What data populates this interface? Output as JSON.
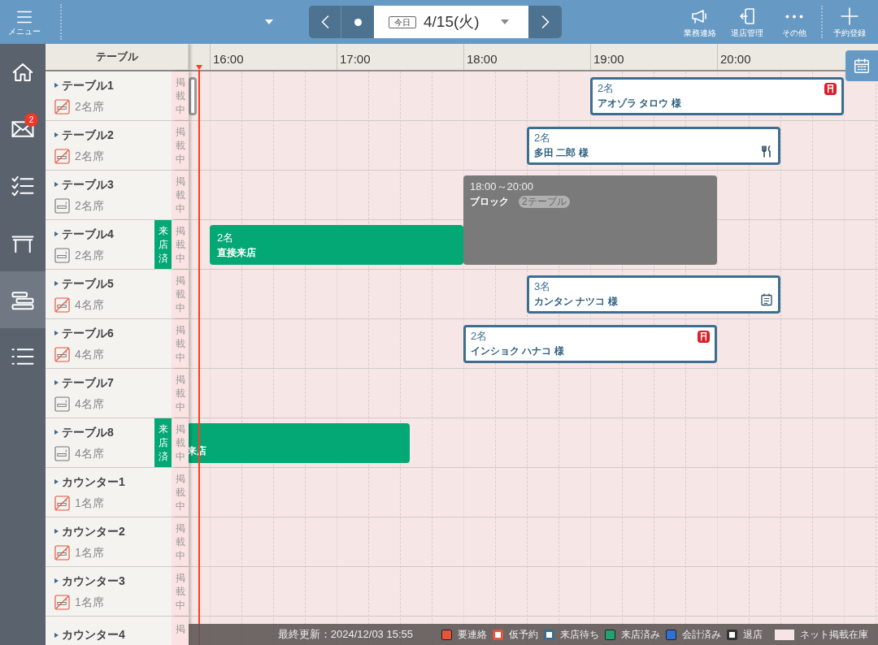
{
  "header": {
    "menu_label": "メニュー",
    "today_label": "今日",
    "date": "4/15(火)",
    "actions": [
      {
        "kind": "megaphone",
        "label": "業務連絡"
      },
      {
        "kind": "exit",
        "label": "退店管理"
      },
      {
        "kind": "more",
        "label": "その他"
      },
      {
        "kind": "plus",
        "label": "予約登録"
      }
    ]
  },
  "sidebar": {
    "items": [
      {
        "kind": "home",
        "selected": false
      },
      {
        "kind": "mail",
        "selected": false,
        "badge": "2"
      },
      {
        "kind": "checklist",
        "selected": false
      },
      {
        "kind": "table",
        "selected": false
      },
      {
        "kind": "timeline",
        "selected": true
      },
      {
        "kind": "list",
        "selected": false
      }
    ]
  },
  "timeline": {
    "column_header": "テーブル",
    "hours": [
      "16:00",
      "17:00",
      "18:00",
      "19:00",
      "20:00"
    ],
    "rows": [
      {
        "name": "テーブル1",
        "seats": "2名席",
        "smoking": false,
        "listed": "掲載中",
        "bookings": [
          {
            "kind": "edge"
          },
          {
            "kind": "reserved",
            "party": "2名",
            "guest": "アオゾラ タロウ 様",
            "marks": [
              {
                "kind": "chair"
              }
            ]
          }
        ]
      },
      {
        "name": "テーブル2",
        "seats": "2名席",
        "smoking": false,
        "listed": "掲載中",
        "bookings": [
          {
            "kind": "reserved",
            "party": "2名",
            "guest": "多田 二郎 様",
            "marks": [
              {
                "kind": "meal"
              }
            ]
          }
        ]
      },
      {
        "name": "テーブル3",
        "seats": "2名席",
        "smoking": true,
        "listed": "掲載中",
        "bookings": [
          {
            "kind": "block",
            "time": "18:00～20:00",
            "title": "ブロック",
            "tag": "2テーブル"
          }
        ]
      },
      {
        "name": "テーブル4",
        "seats": "2名席",
        "smoking": true,
        "listed": "掲載中",
        "visited": "来店済",
        "bookings": [
          {
            "kind": "visited",
            "party": "2名",
            "guest": "直接来店"
          }
        ]
      },
      {
        "name": "テーブル5",
        "seats": "4名席",
        "smoking": false,
        "listed": "掲載中",
        "bookings": [
          {
            "kind": "reserved",
            "party": "3名",
            "guest": "カンタン ナツコ 様",
            "marks": [
              {
                "kind": "memo"
              }
            ]
          }
        ]
      },
      {
        "name": "テーブル6",
        "seats": "4名席",
        "smoking": false,
        "listed": "掲載中",
        "bookings": [
          {
            "kind": "reserved",
            "party": "2名",
            "guest": "インショク ハナコ 様",
            "marks": [
              {
                "kind": "chair"
              }
            ]
          }
        ]
      },
      {
        "name": "テーブル7",
        "seats": "4名席",
        "smoking": true,
        "listed": "掲載中",
        "bookings": []
      },
      {
        "name": "テーブル8",
        "seats": "4名席",
        "smoking": true,
        "listed": "掲載中",
        "visited": "来店済",
        "bookings": [
          {
            "kind": "visited",
            "guest": "来店"
          }
        ]
      },
      {
        "name": "カウンター1",
        "seats": "1名席",
        "smoking": false,
        "listed": "掲載中",
        "bookings": []
      },
      {
        "name": "カウンター2",
        "seats": "1名席",
        "smoking": false,
        "listed": "掲載中",
        "bookings": []
      },
      {
        "name": "カウンター3",
        "seats": "1名席",
        "smoking": false,
        "listed": "掲載中",
        "bookings": []
      },
      {
        "name": "カウンター4",
        "listed": "掲",
        "bookings": []
      }
    ]
  },
  "status_bar": {
    "updated": "最終更新：2024/12/03 15:55",
    "legend": [
      {
        "kind": "fill",
        "color": "#e8533a",
        "label": "要連絡"
      },
      {
        "kind": "outline",
        "color": "#e8533a",
        "label": "仮予約"
      },
      {
        "kind": "outline",
        "color": "#3c6f8f",
        "label": "来店待ち"
      },
      {
        "kind": "fill",
        "color": "#1fa56b",
        "label": "来店済み"
      },
      {
        "kind": "fill",
        "color": "#2f6fd6",
        "label": "会計済み"
      },
      {
        "kind": "outline",
        "color": "#333333",
        "label": "退店"
      },
      {
        "kind": "wide",
        "color": "#f7e4e4",
        "label": "ネット掲載在庫"
      }
    ]
  }
}
